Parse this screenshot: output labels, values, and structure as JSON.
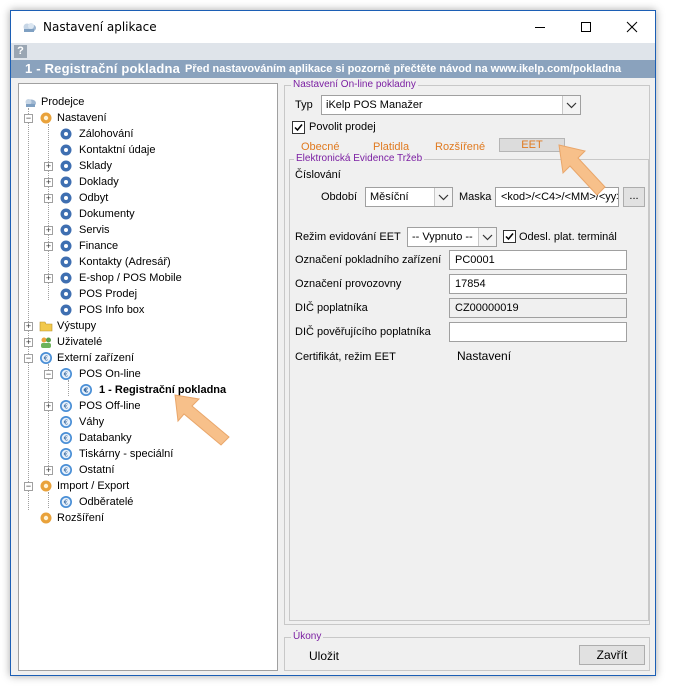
{
  "window": {
    "title": "Nastavení aplikace"
  },
  "help": {
    "icon": "?"
  },
  "banner": {
    "title": "1 - Registrační pokladna",
    "note": "Před nastavováním aplikace si pozorně přečtěte návod na www.ikelp.com/pokladna"
  },
  "tree": {
    "prodejce": "Prodejce",
    "nastaveni": "Nastavení",
    "zalohovani": "Zálohování",
    "kontaktni": "Kontaktní údaje",
    "sklady": "Sklady",
    "doklady": "Doklady",
    "odbyt": "Odbyt",
    "dokumenty": "Dokumenty",
    "servis": "Servis",
    "finance": "Finance",
    "kontakty": "Kontakty (Adresář)",
    "eshop": "E-shop / POS Mobile",
    "posprodej": "POS Prodej",
    "posinfo": "POS Info box",
    "vystupy": "Výstupy",
    "uzivatele": "Uživatelé",
    "externi": "Externí zařízení",
    "posonline": "POS On-line",
    "registracni": "1 - Registrační pokladna",
    "posoffline": "POS Off-line",
    "vahy": "Váhy",
    "databanky": "Databanky",
    "tiskarny": "Tiskárny - speciální",
    "ostatni": "Ostatní",
    "import": "Import / Export",
    "odberatele": "Odběratelé",
    "rozsireni": "Rozšíření"
  },
  "online": {
    "group_label": "Nastavení On-line pokladny",
    "typ_label": "Typ",
    "typ_value": "iKelp POS Manažer",
    "povolit_label": "Povolit prodej",
    "povolit_checked": true,
    "tabs": [
      "Obecné",
      "Platidla",
      "Rozšířené",
      "EET"
    ]
  },
  "eet": {
    "group_label": "Elektronická Evidence Tržeb",
    "cislovani_label": "Číslování",
    "obdobi_label": "Období",
    "obdobi_value": "Měsíční",
    "maska_label": "Maska",
    "maska_value": "<kod>/<C4>/<MM>/<yy>",
    "browse_label": "...",
    "rezim_label": "Režim evidování EET",
    "rezim_value": "-- Vypnuto --",
    "odesl_label": "Odesl. plat. terminál",
    "odesl_checked": true,
    "oznaceni_zarizeni_label": "Označení pokladního zařízení",
    "oznaceni_zarizeni_value": "PC0001",
    "oznaceni_provozovny_label": "Označení provozovny",
    "oznaceni_provozovny_value": "17854",
    "dic_label": "DIČ poplatníka",
    "dic_value": "CZ00000019",
    "dic_poverujici_label": "DIČ pověřujícího poplatníka",
    "dic_poverujici_value": "",
    "certifikat_label": "Certifikát, režim EET",
    "certifikat_value": "Nastavení"
  },
  "ukony": {
    "group_label": "Úkony",
    "ulozit": "Uložit",
    "zavrit": "Zavřít"
  },
  "colors": {
    "banner": "#8aa2bd",
    "group_label": "#7b1fa2",
    "tab_text": "#e07a20",
    "arrow": "#f7c08a"
  }
}
